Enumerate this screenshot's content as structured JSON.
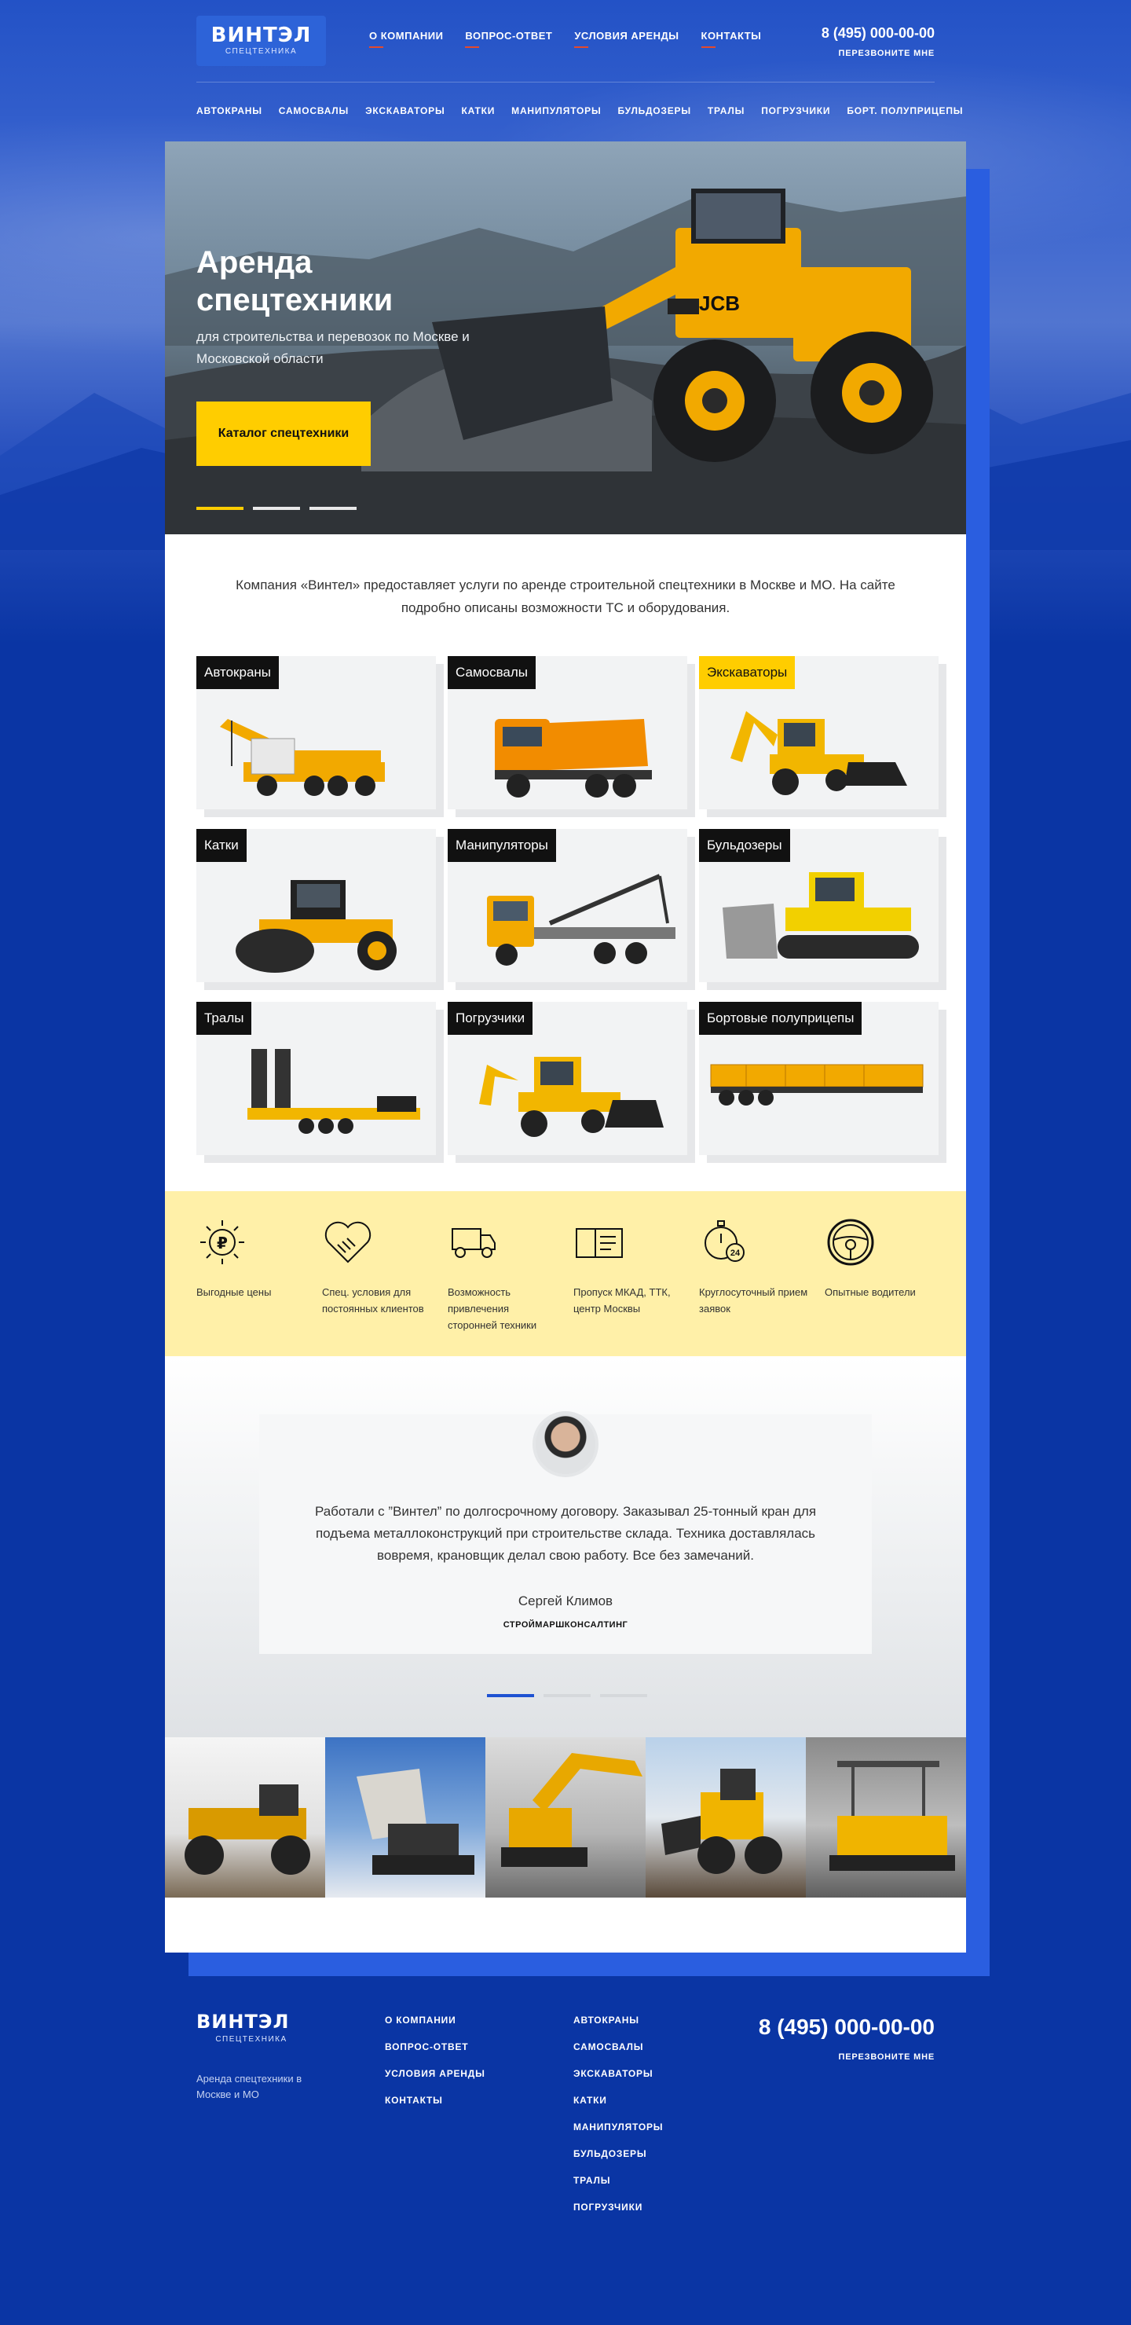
{
  "header": {
    "logo_title": "ВИНТЭЛ",
    "logo_subtitle": "СПЕЦТЕХНИКА",
    "nav": [
      "О КОМПАНИИ",
      "ВОПРОС-ОТВЕТ",
      "УСЛОВИЯ АРЕНДЫ",
      "КОНТАКТЫ"
    ],
    "phone": "8 (495) 000-00-00",
    "callback": "ПЕРЕЗВОНИТЕ МНЕ",
    "categories": [
      "АВТОКРАНЫ",
      "САМОСВАЛЫ",
      "ЭКСКАВАТОРЫ",
      "КАТКИ",
      "МАНИПУЛЯТОРЫ",
      "БУЛЬДОЗЕРЫ",
      "ТРАЛЫ",
      "ПОГРУЗЧИКИ",
      "БОРТ. ПОЛУПРИЦЕПЫ"
    ]
  },
  "hero": {
    "title": "Аренда спецтехники",
    "subtitle": "для строительства и перевозок по Москве и Московской области",
    "button": "Каталог спецтехники",
    "slides": 3,
    "active_slide": 1
  },
  "intro": "Компания «Винтел» предоставляет услуги по аренде строительной спецтехники в Москве и МО. На сайте подробно описаны возможности ТС и оборудования.",
  "catalog": [
    {
      "label": "Автокраны",
      "highlight": false
    },
    {
      "label": "Самосвалы",
      "highlight": false
    },
    {
      "label": "Экскаваторы",
      "highlight": true
    },
    {
      "label": "Катки",
      "highlight": false
    },
    {
      "label": "Манипуляторы",
      "highlight": false
    },
    {
      "label": "Бульдозеры",
      "highlight": false
    },
    {
      "label": "Тралы",
      "highlight": false
    },
    {
      "label": "Погрузчики",
      "highlight": false
    },
    {
      "label": "Бортовые полуприцепы",
      "highlight": false
    }
  ],
  "features": [
    {
      "icon": "ruble-sun-icon",
      "text": "Выгодные цены"
    },
    {
      "icon": "handshake-heart-icon",
      "text": "Спец. условия для постоянных клиентов"
    },
    {
      "icon": "truck-icon",
      "text": "Возможность привлечения сторонней техники"
    },
    {
      "icon": "pass-card-icon",
      "text": "Пропуск МКАД, ТТК, центр Москвы"
    },
    {
      "icon": "stopwatch-24-icon",
      "text": "Круглосуточный прием заявок"
    },
    {
      "icon": "steering-wheel-icon",
      "text": "Опытные водители"
    }
  ],
  "testimonial": {
    "quote": "Работали с ”Винтел” по долгосрочному договору. Заказывал 25-тонный кран для подъема металлоконструкций при строительстве склада. Техника доставлялась вовремя, крановщик делал свою работу. Все без замечаний.",
    "name": "Сергей Климов",
    "company": "СТРОЙМАРШКОНСАЛТИНГ",
    "slides": 3,
    "active_slide": 1
  },
  "footer": {
    "logo_title": "ВИНТЭЛ",
    "logo_subtitle": "СПЕЦТЕХНИКА",
    "description": "Аренда спецтехники в Москве и МО",
    "col1": [
      "О КОМПАНИИ",
      "ВОПРОС-ОТВЕТ",
      "УСЛОВИЯ АРЕНДЫ",
      "КОНТАКТЫ"
    ],
    "col2": [
      "АВТОКРАНЫ",
      "САМОСВАЛЫ",
      "ЭКСКАВАТОРЫ",
      "КАТКИ",
      "МАНИПУЛЯТОРЫ",
      "БУЛЬДОЗЕРЫ",
      "ТРАЛЫ",
      "ПОГРУЗЧИКИ"
    ],
    "phone": "8 (495) 000-00-00",
    "callback": "ПЕРЕЗВОНИТЕ МНЕ"
  },
  "colors": {
    "brand_blue": "#0a35a4",
    "accent_yellow": "#ffcd00",
    "accent_red": "#e54a2c"
  }
}
